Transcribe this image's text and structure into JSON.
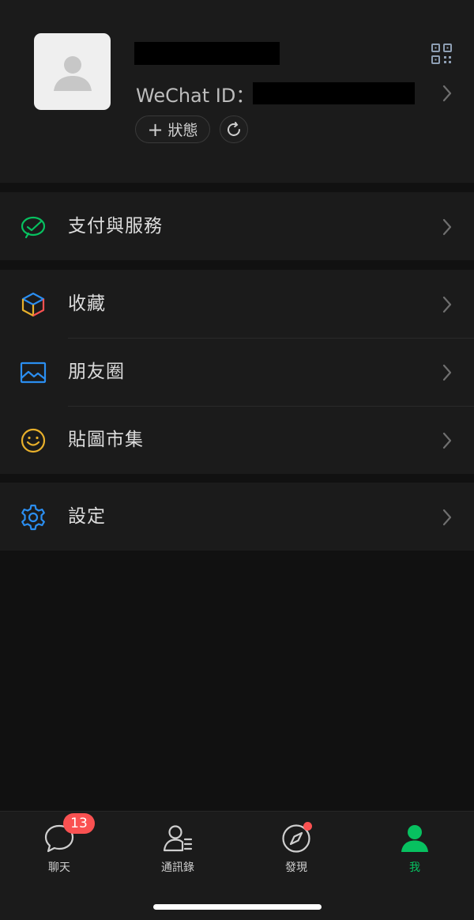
{
  "profile": {
    "wechat_id_label": "WeChat ID：",
    "status_label": "狀態",
    "status_plus": "+"
  },
  "menu": {
    "pay": "支付與服務",
    "favorites": "收藏",
    "moments": "朋友圈",
    "stickers": "貼圖市集",
    "settings": "設定"
  },
  "tabs": {
    "chats": "聊天",
    "chats_badge": "13",
    "contacts": "通訊錄",
    "discover": "發現",
    "me": "我"
  },
  "colors": {
    "accent": "#07c160",
    "badge": "#fa5151",
    "blue": "#2b8ef0",
    "yellow": "#e8b02b"
  }
}
